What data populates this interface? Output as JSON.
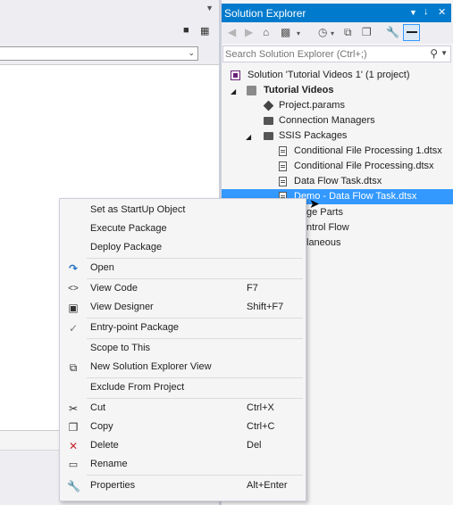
{
  "solution_explorer": {
    "title": "Solution Explorer",
    "title_buttons": [
      "chevron-down-icon",
      "pin-icon",
      "close-icon"
    ],
    "search": {
      "placeholder": "Search Solution Explorer (Ctrl+;)"
    },
    "tree": [
      {
        "label": "Solution 'Tutorial Videos 1' (1 project)",
        "icon": "solution-icon",
        "level": 0
      },
      {
        "label": "Tutorial Videos",
        "icon": "ssis-project-icon",
        "level": 1,
        "expanded": true,
        "bold": true
      },
      {
        "label": "Project.params",
        "icon": "params-icon",
        "level": 2
      },
      {
        "label": "Connection Managers",
        "icon": "folder-icon",
        "level": 2
      },
      {
        "label": "SSIS Packages",
        "icon": "folder-icon",
        "level": 2,
        "expanded": true
      },
      {
        "label": "Conditional File Processing 1.dtsx",
        "icon": "package-icon",
        "level": 3
      },
      {
        "label": "Conditional File Processing.dtsx",
        "icon": "package-icon",
        "level": 3
      },
      {
        "label": "Data Flow Task.dtsx",
        "icon": "package-icon",
        "level": 3
      },
      {
        "label": "Demo - Data Flow Task.dtsx",
        "icon": "package-icon",
        "level": 3,
        "selected": true
      },
      {
        "label": "ge Parts",
        "level": 2
      },
      {
        "label": "ntrol Flow",
        "level": 2
      },
      {
        "label": "laneous",
        "level": 2
      }
    ]
  },
  "context_menu": {
    "items": [
      {
        "label": "Set as StartUp Object",
        "shortcut": "",
        "icon": ""
      },
      {
        "label": "Execute Package",
        "shortcut": "",
        "icon": ""
      },
      {
        "label": "Deploy Package",
        "shortcut": "",
        "icon": ""
      },
      {
        "label": "Open",
        "shortcut": "",
        "icon": "open-icon"
      },
      {
        "label": "View Code",
        "shortcut": "F7",
        "icon": "code-icon"
      },
      {
        "label": "View Designer",
        "shortcut": "Shift+F7",
        "icon": "designer-icon"
      },
      {
        "label": "Entry-point Package",
        "shortcut": "",
        "icon": "check-icon"
      },
      {
        "label": "Scope to This",
        "shortcut": "",
        "icon": ""
      },
      {
        "label": "New Solution Explorer View",
        "shortcut": "",
        "icon": "new-view-icon"
      },
      {
        "label": "Exclude From Project",
        "shortcut": "",
        "icon": ""
      },
      {
        "label": "Cut",
        "shortcut": "Ctrl+X",
        "icon": "cut-icon"
      },
      {
        "label": "Copy",
        "shortcut": "Ctrl+C",
        "icon": "copy-icon"
      },
      {
        "label": "Delete",
        "shortcut": "Del",
        "icon": "delete-icon"
      },
      {
        "label": "Rename",
        "shortcut": "",
        "icon": "rename-icon"
      },
      {
        "label": "Properties",
        "shortcut": "Alt+Enter",
        "icon": "wrench-icon"
      }
    ]
  },
  "colors": {
    "accent": "#007acc",
    "selection": "#3399ff",
    "delete_icon": "#c4262c",
    "open_icon": "#1e6fc4"
  }
}
